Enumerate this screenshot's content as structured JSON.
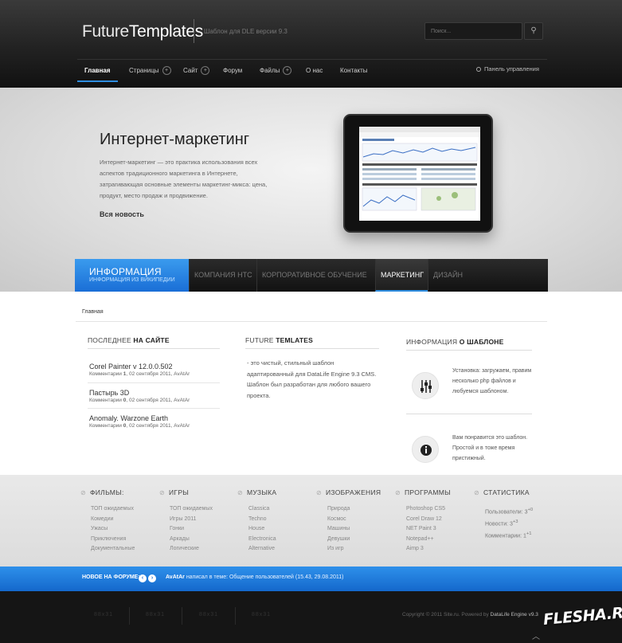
{
  "header": {
    "logo_a": "Future",
    "logo_b": "Templates",
    "tagline": "Шаблон для DLE версии 9.3",
    "search_placeholder": "Поиск...",
    "search_icon": "search-icon"
  },
  "nav": {
    "items": [
      {
        "label": "Главная"
      },
      {
        "label": "Страницы"
      },
      {
        "label": "Сайт"
      },
      {
        "label": "Форум"
      },
      {
        "label": "Файлы"
      },
      {
        "label": "О нас"
      },
      {
        "label": "Контакты"
      }
    ],
    "plus": "+",
    "panel": "Панель управления"
  },
  "hero": {
    "title": "Интернет-маркетинг",
    "text": "Интернет-маркетинг — это практика использования всех аспектов традиционного маркетинга в Интернете, затрагивающая основные элементы маркетинг-микса: цена, продукт, место продаж и продвижение.",
    "more": "Вся новость"
  },
  "tabs": {
    "info_title": "ИНФОРМАЦИЯ",
    "info_sub": "ИНФОРМАЦИЯ ИЗ ВИКИПЕДИИ",
    "items": [
      {
        "label": "КОМПАНИЯ НТС"
      },
      {
        "label": "КОРПОРАТИВНОЕ ОБУЧЕНИЕ"
      },
      {
        "label": "МАРКЕТИНГ"
      },
      {
        "label": "ДИЗАЙН"
      }
    ]
  },
  "breadcrumb": "Главная",
  "latest": {
    "title_a": "ПОСЛЕДНЕЕ",
    "title_b": "НА САЙТЕ",
    "items": [
      {
        "title": "Corel Painter v 12.0.0.502",
        "meta_a": "Комментарии",
        "count": "1",
        "meta_b": ", 02 сентября 2011, AvAtAr"
      },
      {
        "title": "Пастырь 3D",
        "meta_a": "Комментарии",
        "count": "0",
        "meta_b": ", 02 сентября 2011, AvAtAr"
      },
      {
        "title": "Anomaly. Warzone Earth",
        "meta_a": "Комментарии",
        "count": "0",
        "meta_b": ", 02 сентября 2011, AvAtAr"
      }
    ]
  },
  "about": {
    "title_a": "FUTURE",
    "title_b": "TEMLATES",
    "text": "- это чистый, стильный шаблон адаптированный для DataLife Engine 9.3 CMS. Шаблон был разработан для любого вашего проекта."
  },
  "template_info": {
    "title_a": "ИНФОРМАЦИЯ",
    "title_b": "О ШАБЛОНЕ",
    "items": [
      {
        "icon": "sliders-icon",
        "text": "Установка: загружаем, правим несколько php файлов и любуемся шаблоном."
      },
      {
        "icon": "info-icon",
        "text": "Вам понравится это шаблон. Простой и в тоже время пристижный."
      }
    ]
  },
  "footer_cols": [
    {
      "title": "ФИЛЬМЫ:",
      "links": [
        "ТОП ожидаемых",
        "Комедии",
        "Ужасы",
        "Приключения",
        "Документальные"
      ]
    },
    {
      "title": "ИГРЫ",
      "links": [
        "ТОП ожидаемых",
        "Игры 2011",
        "Гонки",
        "Аркады",
        "Логические"
      ]
    },
    {
      "title": "МУЗЫКА",
      "links": [
        "Classica",
        "Techno",
        "House",
        "Electronica",
        "Alternative"
      ]
    },
    {
      "title": "ИЗОБРАЖЕНИЯ",
      "links": [
        "Природа",
        "Космос",
        "Машины",
        "Девушки",
        "Из игр"
      ]
    },
    {
      "title": "ПРОГРАММЫ",
      "links": [
        "Photoshop CS5",
        "Corel Draw 12",
        "NET Paint 3",
        "Notepad++",
        "Aimp 3"
      ]
    },
    {
      "title": "СТАТИСТИКА",
      "stats": [
        {
          "label": "Пользователи:",
          "value": "3",
          "sup": "+0"
        },
        {
          "label": "Новости:",
          "value": "3",
          "sup": "+3"
        },
        {
          "label": "Комментарии:",
          "value": "1",
          "sup": "+1"
        }
      ]
    }
  ],
  "forum": {
    "label": "НОВОЕ НА ФОРУМЕ:",
    "prev": "‹",
    "next": "›",
    "user": "AvAtAr",
    "message": "написал в теме: Общение пользователей (15.43, 29.08.2011)"
  },
  "bottom": {
    "counters": [
      "88x31",
      "88x31",
      "88x31",
      "88x31"
    ],
    "copyright_a": "Copyright © 2011 Site.ru. Powered by",
    "copyright_b": "DataLife Engine v9.3",
    "watermark": "FLESHA.RU",
    "up": "︿"
  },
  "colors": {
    "accent": "#2e8de0",
    "header_bg": "#222222",
    "forum_bar": "#1a74d8"
  }
}
